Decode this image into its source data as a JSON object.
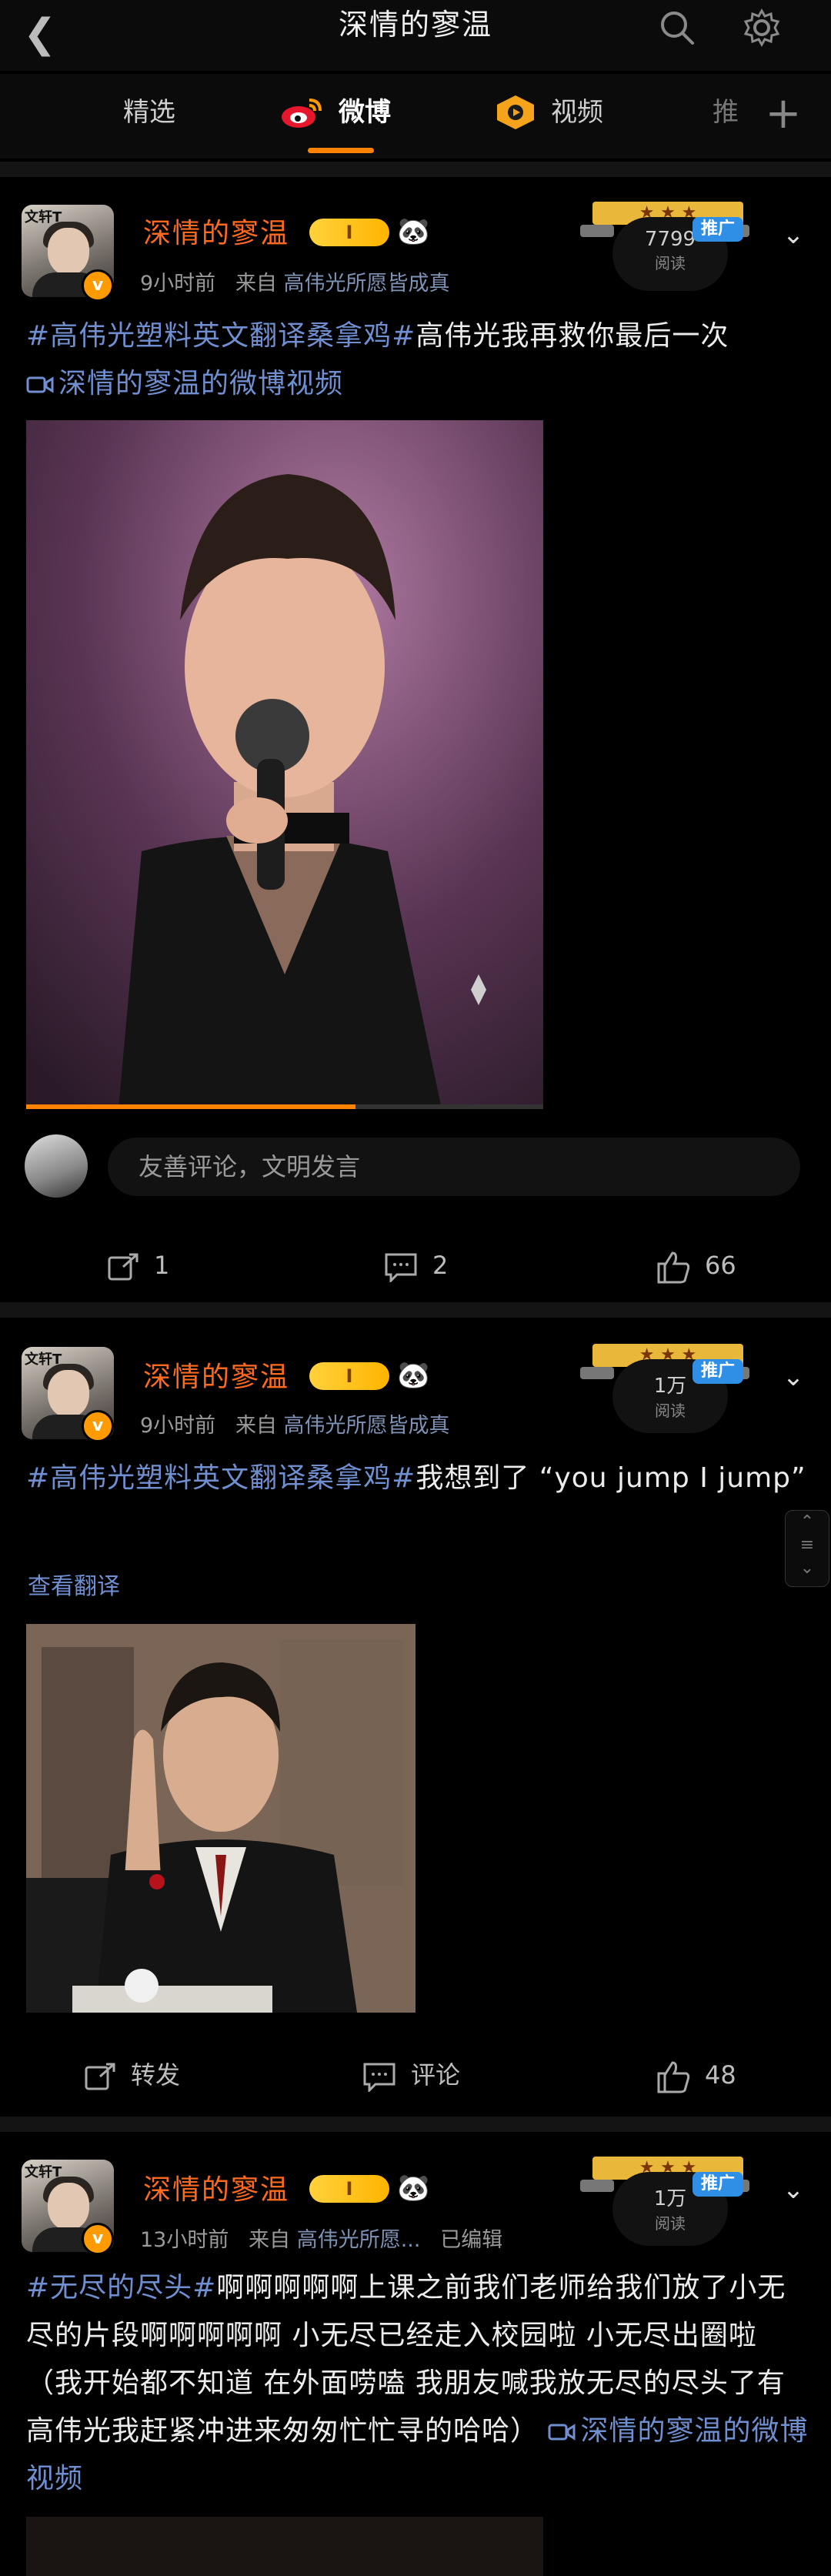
{
  "header": {
    "title": "深情的寥温"
  },
  "tabs": [
    {
      "label": "精选"
    },
    {
      "label": "微博"
    },
    {
      "label": "视频"
    },
    {
      "label": "推"
    }
  ],
  "posts": [
    {
      "username": "深情的寥温",
      "vip_level": "I",
      "time": "9小时前",
      "from_label": "来自",
      "source": "高伟光所愿皆成真",
      "promo_tag": "推广",
      "read_count": "7799",
      "read_label": "阅读",
      "hashtag": "#高伟光塑料英文翻译桑拿鸡#",
      "text": "高伟光我再救你最后一次",
      "video_link": "深情的寥温的微博视频",
      "comment_placeholder": "友善评论，文明发言",
      "reposts": "1",
      "comments": "2",
      "likes": "66"
    },
    {
      "username": "深情的寥温",
      "vip_level": "I",
      "time": "9小时前",
      "from_label": "来自",
      "source": "高伟光所愿皆成真",
      "promo_tag": "推广",
      "read_count": "1万",
      "read_label": "阅读",
      "hashtag": "#高伟光塑料英文翻译桑拿鸡#",
      "text": "我想到了 “you jump I jump”",
      "translate_label": "查看翻译",
      "repost_label": "转发",
      "comment_label": "评论",
      "likes": "48"
    },
    {
      "username": "深情的寥温",
      "vip_level": "I",
      "time": "13小时前",
      "from_label": "来自",
      "source": "高伟光所愿...",
      "edited": "已编辑",
      "promo_tag": "推广",
      "read_count": "1万",
      "read_label": "阅读",
      "hashtag": "#无尽的尽头#",
      "text": "啊啊啊啊啊上课之前我们老师给我们放了小无尽的片段啊啊啊啊啊 小无尽已经走入校园啦 小无尽出圈啦（我开始都不知道 在外面唠嗑 我朋友喊我放无尽的尽头了有高伟光我赶紧冲进来匆匆忙忙寻的哈哈）",
      "video_link": "深情的寥温的微博视频"
    }
  ],
  "avatar_text": "文轩T",
  "colors": {
    "accent": "#ff8200",
    "username": "#ff6a1f",
    "link": "#6f8fd1",
    "promo": "#2f8fe6"
  }
}
